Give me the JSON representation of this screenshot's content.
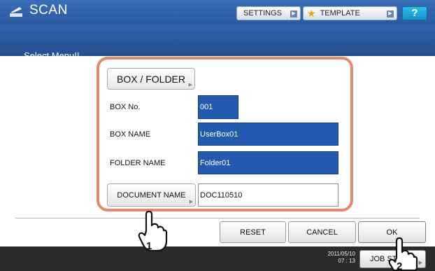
{
  "header": {
    "title": "SCAN",
    "settings_label": "SETTINGS",
    "template_label": "TEMPLATE",
    "help_label": "?",
    "subtitle": "Select Menu!!"
  },
  "form": {
    "box_folder_button": "BOX / FOLDER",
    "box_no_label": "BOX No.",
    "box_no_value": "001",
    "box_name_label": "BOX NAME",
    "box_name_value": "UserBox01",
    "folder_name_label": "FOLDER NAME",
    "folder_name_value": "Folder01",
    "document_name_button": "DOCUMENT NAME",
    "document_name_value": "DOC110510"
  },
  "actions": {
    "reset": "RESET",
    "cancel": "CANCEL",
    "ok": "OK"
  },
  "footer": {
    "date": "2011/05/10",
    "time": "07 : 13",
    "job_status": "JOB STATUS"
  },
  "callouts": {
    "step1": "1",
    "step2": "2"
  },
  "colors": {
    "header_blue": "#2b5aa0",
    "field_blue": "#2359ae",
    "highlight_frame": "#e48a6c"
  }
}
